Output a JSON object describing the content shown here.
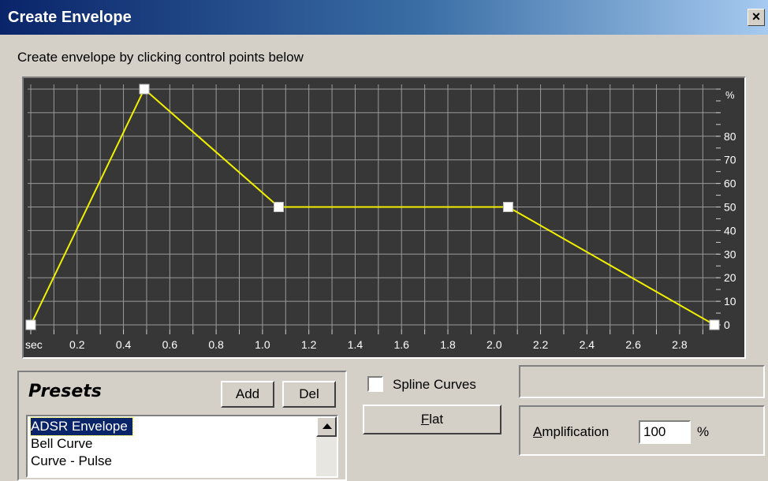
{
  "window": {
    "title": "Create Envelope",
    "close_label": "×"
  },
  "instruction": "Create envelope by clicking control points below",
  "graph": {
    "x_unit_label": "sec",
    "y_unit_label": "%",
    "x_ticks": [
      "0.2",
      "0.4",
      "0.6",
      "0.8",
      "1.0",
      "1.2",
      "1.4",
      "1.6",
      "1.8",
      "2.0",
      "2.2",
      "2.4",
      "2.6",
      "2.8"
    ],
    "y_ticks": [
      "80",
      "70",
      "60",
      "50",
      "40",
      "30",
      "20",
      "10",
      "0"
    ],
    "line_color": "#f0f000",
    "point_color": "#ffffff",
    "background_color": "#373737",
    "grid_color": "#9a9a9a",
    "control_points": [
      {
        "t": 0.0,
        "pct": 0
      },
      {
        "t": 0.49,
        "pct": 100
      },
      {
        "t": 1.07,
        "pct": 50
      },
      {
        "t": 2.06,
        "pct": 50
      },
      {
        "t": 2.95,
        "pct": 0
      }
    ]
  },
  "presets": {
    "title": "Presets",
    "add_label": "Add",
    "del_label": "Del",
    "items": [
      "ADSR Envelope",
      "Bell Curve",
      "Curve - Pulse"
    ],
    "selected_index": 0
  },
  "options": {
    "spline_label": "Spline Curves",
    "spline_checked": false,
    "flat_label": "Flat",
    "flat_mnemonic": "F"
  },
  "amplification": {
    "label": "Amplification",
    "mnemonic": "A",
    "value": "100",
    "unit": "%"
  }
}
